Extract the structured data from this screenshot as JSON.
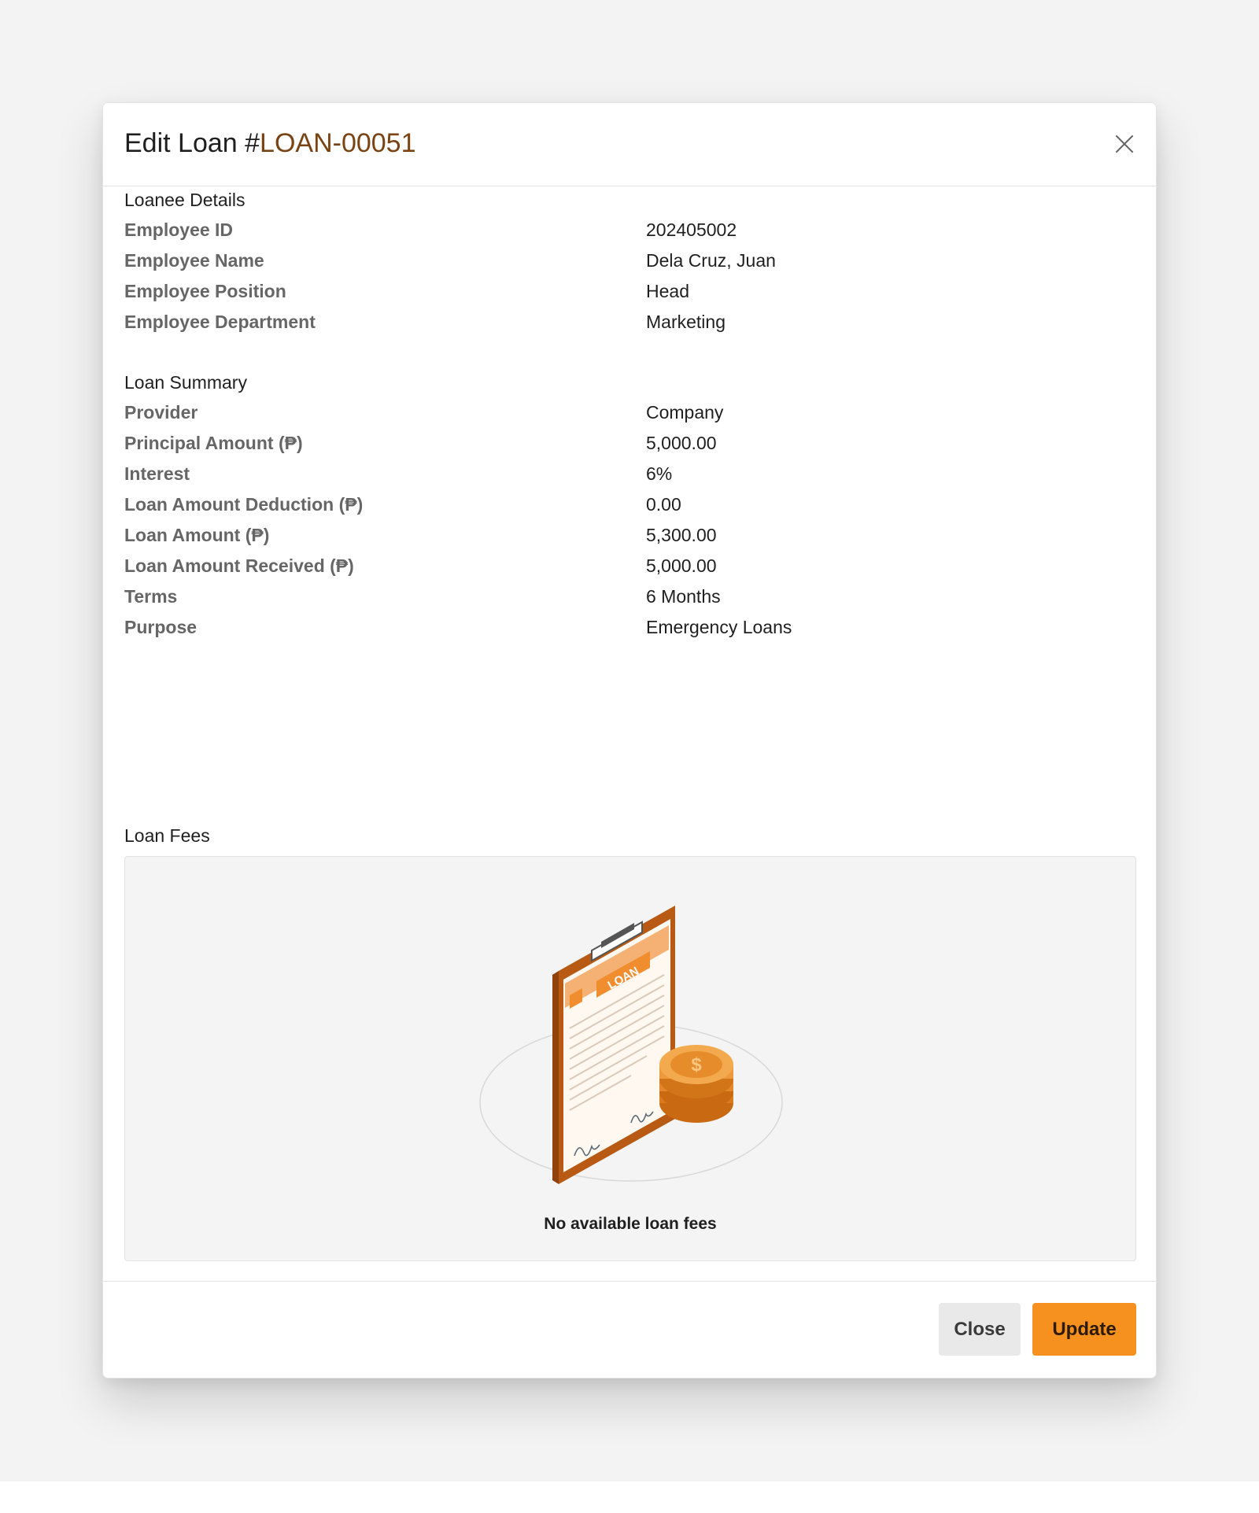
{
  "modal": {
    "title_prefix": "Edit Loan #",
    "loan_id": "LOAN-00051"
  },
  "loanee": {
    "title": "Loanee Details",
    "rows": [
      {
        "label": "Employee ID",
        "value": "202405002"
      },
      {
        "label": "Employee Name",
        "value": "Dela Cruz, Juan"
      },
      {
        "label": "Employee Position",
        "value": "Head"
      },
      {
        "label": "Employee Department",
        "value": "Marketing"
      }
    ]
  },
  "summary": {
    "title": "Loan Summary",
    "rows": [
      {
        "label": "Provider",
        "value": "Company"
      },
      {
        "label": "Principal Amount (₱)",
        "value": "5,000.00"
      },
      {
        "label": "Interest",
        "value": "6%"
      },
      {
        "label": "Loan Amount Deduction (₱)",
        "value": "0.00"
      },
      {
        "label": "Loan Amount (₱)",
        "value": "5,300.00"
      },
      {
        "label": "Loan Amount Received (₱)",
        "value": "5,000.00"
      },
      {
        "label": "Terms",
        "value": "6 Months"
      },
      {
        "label": "Purpose",
        "value": "Emergency Loans"
      }
    ]
  },
  "fees": {
    "title": "Loan Fees",
    "illustration_label": "LOAN",
    "empty_message": "No available loan fees"
  },
  "footer": {
    "close_label": "Close",
    "update_label": "Update"
  },
  "colors": {
    "accent": "#f6901e",
    "loan_id": "#7a4313",
    "label": "#666666"
  },
  "icons": {
    "close": "close-icon",
    "illustration": "loan-clipboard-coins-illustration"
  }
}
